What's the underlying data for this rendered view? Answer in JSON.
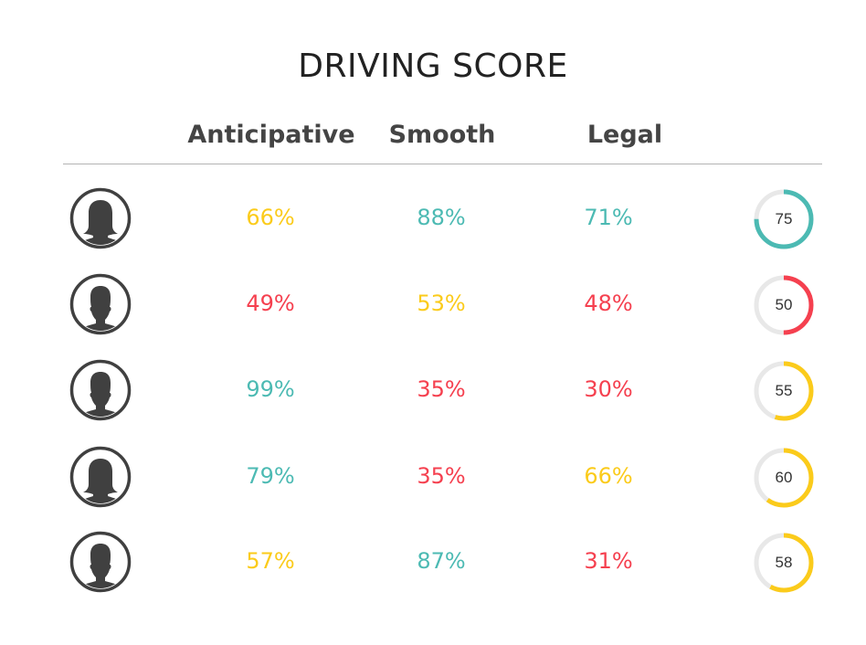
{
  "title": "DRIVING SCORE",
  "columns": [
    "Anticipative",
    "Smooth",
    "Legal"
  ],
  "colors": {
    "good": "#4cbab3",
    "medium": "#fbcb1b",
    "bad": "#f5404f",
    "track": "#e8e8e8",
    "icon": "#404040",
    "divider": "#b3b3b3"
  },
  "drivers": [
    {
      "avatar": "female-avatar-icon",
      "anticipative": {
        "text": "66%",
        "level": "medium"
      },
      "smooth": {
        "text": "88%",
        "level": "good"
      },
      "legal": {
        "text": "71%",
        "level": "good"
      },
      "score": {
        "value": 75,
        "text": "75",
        "level": "good"
      }
    },
    {
      "avatar": "male-avatar-icon",
      "anticipative": {
        "text": "49%",
        "level": "bad"
      },
      "smooth": {
        "text": "53%",
        "level": "medium"
      },
      "legal": {
        "text": "48%",
        "level": "bad"
      },
      "score": {
        "value": 50,
        "text": "50",
        "level": "bad"
      }
    },
    {
      "avatar": "male-avatar-icon",
      "anticipative": {
        "text": "99%",
        "level": "good"
      },
      "smooth": {
        "text": "35%",
        "level": "bad"
      },
      "legal": {
        "text": "30%",
        "level": "bad"
      },
      "score": {
        "value": 55,
        "text": "55",
        "level": "medium"
      }
    },
    {
      "avatar": "female-avatar-icon",
      "anticipative": {
        "text": "79%",
        "level": "good"
      },
      "smooth": {
        "text": "35%",
        "level": "bad"
      },
      "legal": {
        "text": "66%",
        "level": "medium"
      },
      "score": {
        "value": 60,
        "text": "60",
        "level": "medium"
      }
    },
    {
      "avatar": "male-avatar-icon",
      "anticipative": {
        "text": "57%",
        "level": "medium"
      },
      "smooth": {
        "text": "87%",
        "level": "good"
      },
      "legal": {
        "text": "31%",
        "level": "bad"
      },
      "score": {
        "value": 58,
        "text": "58",
        "level": "medium"
      }
    }
  ]
}
